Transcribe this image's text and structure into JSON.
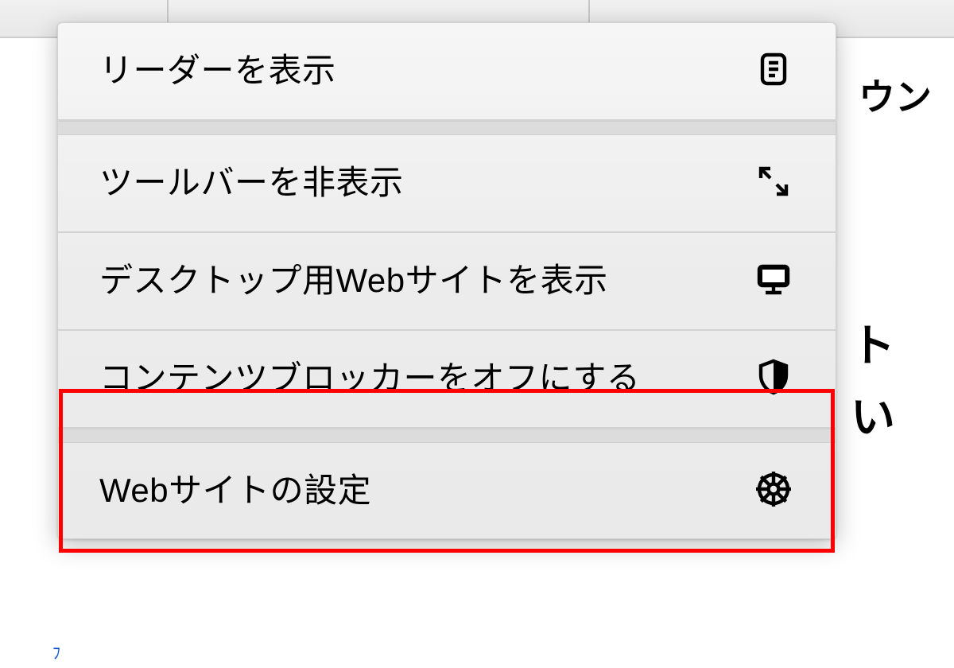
{
  "backdrop": {
    "fragment1": "ウン",
    "fragment2": "ト",
    "fragment3": "い"
  },
  "menu": {
    "items": [
      {
        "label": "リーダーを表示",
        "icon": "reader-icon"
      },
      {
        "label": "ツールバーを非表示",
        "icon": "expand-arrows-icon"
      },
      {
        "label": "デスクトップ用Webサイトを表示",
        "icon": "desktop-icon"
      },
      {
        "label": "コンテンツブロッカーをオフにする",
        "icon": "shield-icon",
        "highlighted": true
      },
      {
        "label": "Webサイトの設定",
        "icon": "gear-icon"
      }
    ]
  },
  "highlight_color": "#ff0000"
}
